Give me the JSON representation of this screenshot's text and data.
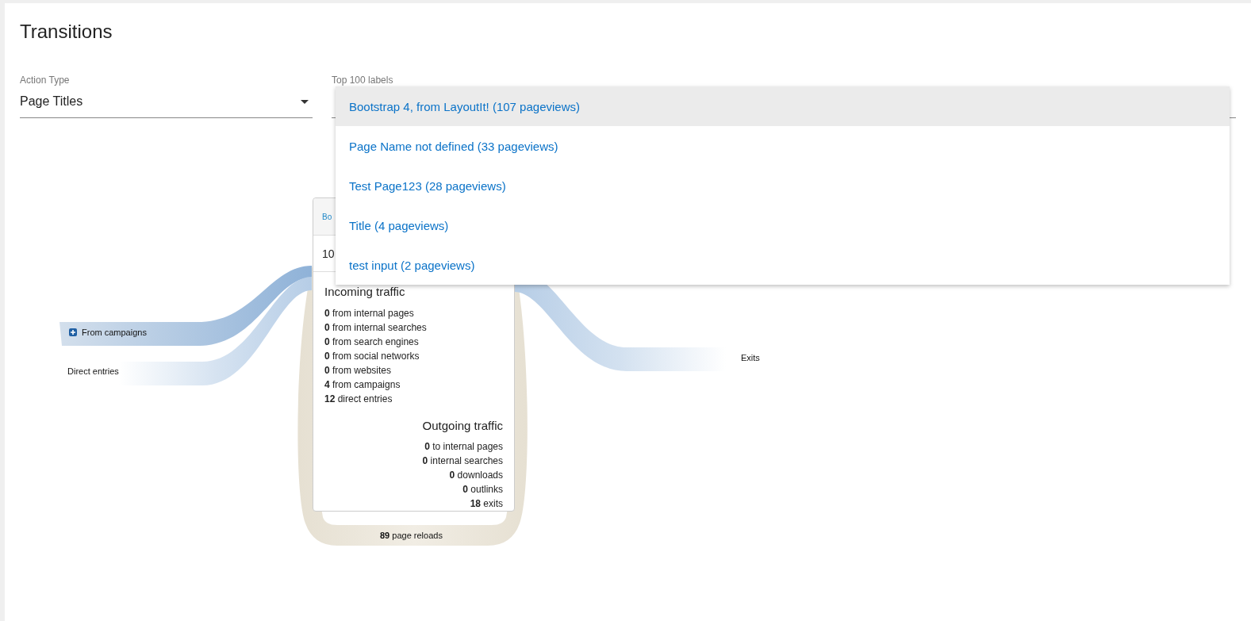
{
  "title": "Transitions",
  "filters": [
    {
      "label": "Action Type",
      "value": "Page Titles"
    },
    {
      "label": "Top 100 labels"
    }
  ],
  "dropdown": {
    "options": [
      {
        "label": "Bootstrap 4, from LayoutIt! (107 pageviews)",
        "selected": true
      },
      {
        "label": "Page Name not defined (33 pageviews)",
        "selected": false
      },
      {
        "label": "Test Page123 (28 pageviews)",
        "selected": false
      },
      {
        "label": "Title (4 pageviews)",
        "selected": false
      },
      {
        "label": "test input (2 pageviews)",
        "selected": false
      }
    ]
  },
  "sources": [
    {
      "label": "From campaigns",
      "expandable": true
    },
    {
      "label": "Direct entries",
      "expandable": false
    }
  ],
  "node": {
    "title": "Bo",
    "count": "10",
    "incoming": {
      "heading": "Incoming traffic",
      "items": [
        {
          "count": "0",
          "text": "from internal pages"
        },
        {
          "count": "0",
          "text": "from internal searches"
        },
        {
          "count": "0",
          "text": "from search engines"
        },
        {
          "count": "0",
          "text": "from social networks"
        },
        {
          "count": "0",
          "text": "from websites"
        },
        {
          "count": "4",
          "text": "from campaigns"
        },
        {
          "count": "12",
          "text": "direct entries"
        }
      ]
    },
    "outgoing": {
      "heading": "Outgoing traffic",
      "items": [
        {
          "count": "0",
          "text": "to internal pages"
        },
        {
          "count": "0",
          "text": "internal searches"
        },
        {
          "count": "0",
          "text": "downloads"
        },
        {
          "count": "0",
          "text": "outlinks"
        },
        {
          "count": "18",
          "text": "exits"
        }
      ]
    },
    "reloads": {
      "count": "89",
      "text": "page reloads"
    }
  },
  "exits": {
    "label": "Exits"
  }
}
